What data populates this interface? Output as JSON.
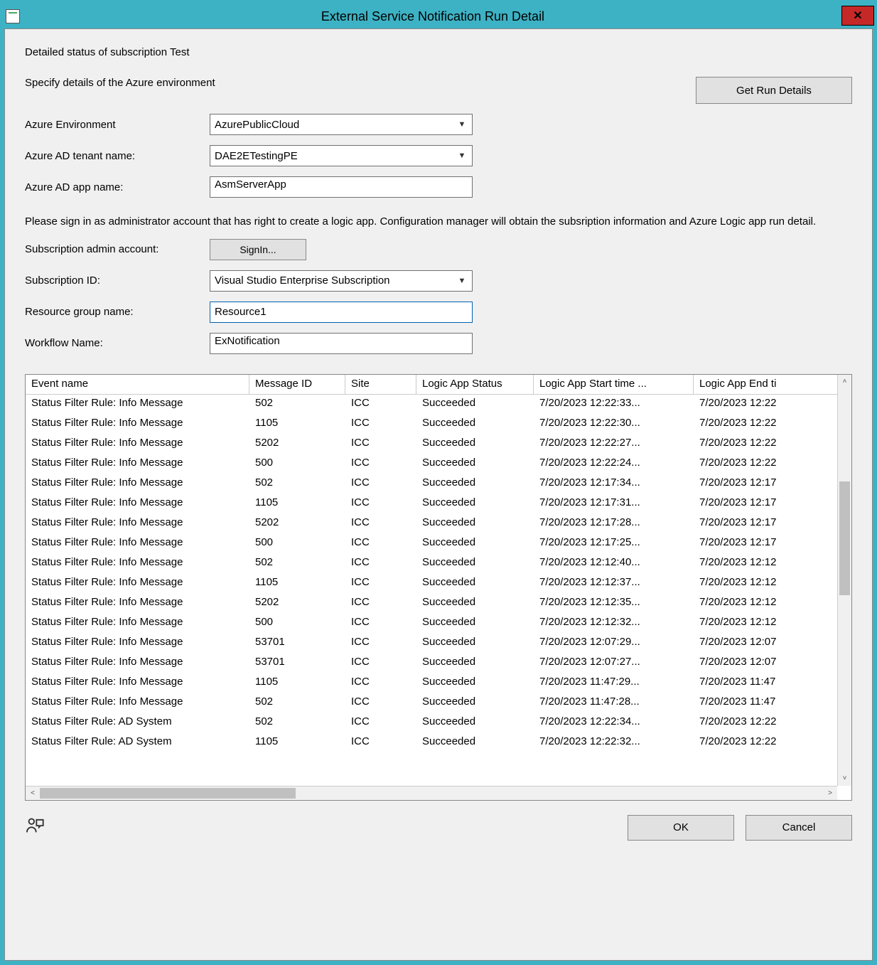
{
  "window": {
    "title": "External Service Notification Run Detail",
    "close_icon": "✕"
  },
  "intro1": "Detailed status of subscription Test",
  "intro2": "Specify details of the Azure environment",
  "buttons": {
    "get_run_details": "Get Run Details",
    "sign_in": "SignIn...",
    "ok": "OK",
    "cancel": "Cancel"
  },
  "labels": {
    "azure_env": "Azure Environment",
    "tenant": "Azure AD tenant name:",
    "app": "Azure AD app name:",
    "admin_account": "Subscription admin account:",
    "sub_id": "Subscription ID:",
    "resource_group": "Resource group name:",
    "workflow": "Workflow Name:"
  },
  "values": {
    "azure_env": "AzurePublicCloud",
    "tenant": "DAE2ETestingPE",
    "app": "AsmServerApp",
    "sub_id": "Visual Studio Enterprise Subscription",
    "resource_group": "Resource1",
    "workflow": "ExNotification"
  },
  "note": "Please sign in as administrator account that has right to create a logic app. Configuration manager will obtain the subsription information and Azure Logic app run detail.",
  "table": {
    "headers": {
      "event": "Event name",
      "msg": "Message ID",
      "site": "Site",
      "status": "Logic App Status",
      "start": "Logic App Start time ...",
      "end": "Logic App End ti"
    },
    "rows": [
      {
        "event": "Status Filter Rule: Info Message",
        "msg": "502",
        "site": "ICC",
        "status": "Succeeded",
        "start": "7/20/2023 12:22:33...",
        "end": "7/20/2023 12:22"
      },
      {
        "event": "Status Filter Rule: Info Message",
        "msg": "1105",
        "site": "ICC",
        "status": "Succeeded",
        "start": "7/20/2023 12:22:30...",
        "end": "7/20/2023 12:22"
      },
      {
        "event": "Status Filter Rule: Info Message",
        "msg": "5202",
        "site": "ICC",
        "status": "Succeeded",
        "start": "7/20/2023 12:22:27...",
        "end": "7/20/2023 12:22"
      },
      {
        "event": "Status Filter Rule: Info Message",
        "msg": "500",
        "site": "ICC",
        "status": "Succeeded",
        "start": "7/20/2023 12:22:24...",
        "end": "7/20/2023 12:22"
      },
      {
        "event": "Status Filter Rule: Info Message",
        "msg": "502",
        "site": "ICC",
        "status": "Succeeded",
        "start": "7/20/2023 12:17:34...",
        "end": "7/20/2023 12:17"
      },
      {
        "event": "Status Filter Rule: Info Message",
        "msg": "1105",
        "site": "ICC",
        "status": "Succeeded",
        "start": "7/20/2023 12:17:31...",
        "end": "7/20/2023 12:17"
      },
      {
        "event": "Status Filter Rule: Info Message",
        "msg": "5202",
        "site": "ICC",
        "status": "Succeeded",
        "start": "7/20/2023 12:17:28...",
        "end": "7/20/2023 12:17"
      },
      {
        "event": "Status Filter Rule: Info Message",
        "msg": "500",
        "site": "ICC",
        "status": "Succeeded",
        "start": "7/20/2023 12:17:25...",
        "end": "7/20/2023 12:17"
      },
      {
        "event": "Status Filter Rule: Info Message",
        "msg": "502",
        "site": "ICC",
        "status": "Succeeded",
        "start": "7/20/2023 12:12:40...",
        "end": "7/20/2023 12:12"
      },
      {
        "event": "Status Filter Rule: Info Message",
        "msg": "1105",
        "site": "ICC",
        "status": "Succeeded",
        "start": "7/20/2023 12:12:37...",
        "end": "7/20/2023 12:12"
      },
      {
        "event": "Status Filter Rule: Info Message",
        "msg": "5202",
        "site": "ICC",
        "status": "Succeeded",
        "start": "7/20/2023 12:12:35...",
        "end": "7/20/2023 12:12"
      },
      {
        "event": "Status Filter Rule: Info Message",
        "msg": "500",
        "site": "ICC",
        "status": "Succeeded",
        "start": "7/20/2023 12:12:32...",
        "end": "7/20/2023 12:12"
      },
      {
        "event": "Status Filter Rule: Info Message",
        "msg": "53701",
        "site": "ICC",
        "status": "Succeeded",
        "start": "7/20/2023 12:07:29...",
        "end": "7/20/2023 12:07"
      },
      {
        "event": "Status Filter Rule: Info Message",
        "msg": "53701",
        "site": "ICC",
        "status": "Succeeded",
        "start": "7/20/2023 12:07:27...",
        "end": "7/20/2023 12:07"
      },
      {
        "event": "Status Filter Rule: Info Message",
        "msg": "1105",
        "site": "ICC",
        "status": "Succeeded",
        "start": "7/20/2023 11:47:29...",
        "end": "7/20/2023 11:47"
      },
      {
        "event": "Status Filter Rule: Info Message",
        "msg": "502",
        "site": "ICC",
        "status": "Succeeded",
        "start": "7/20/2023 11:47:28...",
        "end": "7/20/2023 11:47"
      },
      {
        "event": "Status Filter Rule: AD System",
        "msg": "502",
        "site": "ICC",
        "status": "Succeeded",
        "start": "7/20/2023 12:22:34...",
        "end": "7/20/2023 12:22"
      },
      {
        "event": "Status Filter Rule: AD System",
        "msg": "1105",
        "site": "ICC",
        "status": "Succeeded",
        "start": "7/20/2023 12:22:32...",
        "end": "7/20/2023 12:22"
      }
    ]
  }
}
